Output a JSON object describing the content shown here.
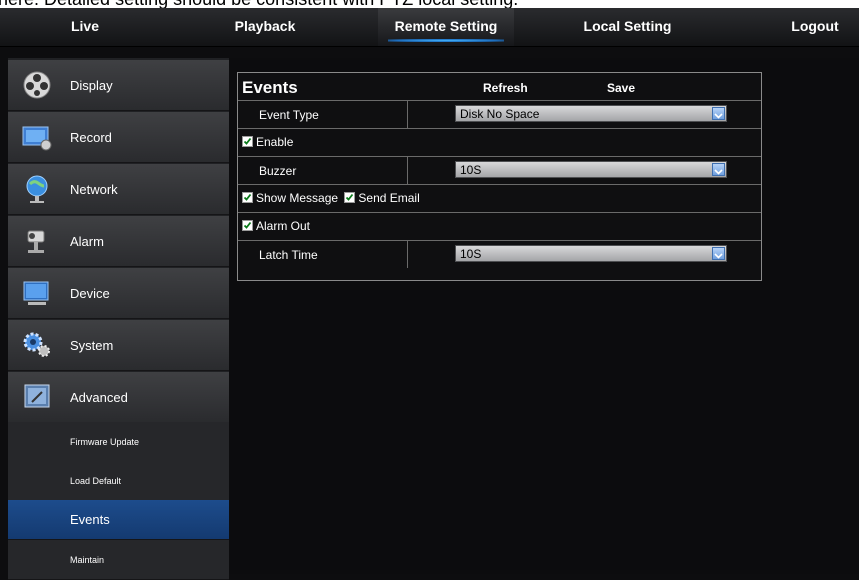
{
  "caption": "here. Detailed setting should be consistent with PTZ local setting.",
  "topnav": {
    "items": [
      {
        "label": "Live"
      },
      {
        "label": "Playback"
      },
      {
        "label": "Remote Setting"
      },
      {
        "label": "Local Setting"
      },
      {
        "label": "Logout"
      }
    ],
    "active": "Remote Setting"
  },
  "sidebar": {
    "items": [
      {
        "label": "Display",
        "icon": "display-icon"
      },
      {
        "label": "Record",
        "icon": "record-icon"
      },
      {
        "label": "Network",
        "icon": "network-icon"
      },
      {
        "label": "Alarm",
        "icon": "alarm-icon"
      },
      {
        "label": "Device",
        "icon": "device-icon"
      },
      {
        "label": "System",
        "icon": "system-icon"
      },
      {
        "label": "Advanced",
        "icon": "advanced-icon"
      }
    ],
    "subitems": [
      {
        "label": "Firmware Update"
      },
      {
        "label": "Load Default"
      },
      {
        "label": "Events"
      },
      {
        "label": "Maintain"
      }
    ],
    "active_subitem": "Events"
  },
  "panel": {
    "title": "Events",
    "refresh_label": "Refresh",
    "save_label": "Save",
    "event_type": {
      "label": "Event Type",
      "value": "Disk No Space"
    },
    "enable": {
      "label": "Enable",
      "checked": true
    },
    "buzzer": {
      "label": "Buzzer",
      "value": "10S"
    },
    "show_message": {
      "label": "Show Message",
      "checked": true
    },
    "send_email": {
      "label": "Send Email",
      "checked": true
    },
    "alarm_out": {
      "label": "Alarm Out",
      "checked": true
    },
    "latch_time": {
      "label": "Latch Time",
      "value": "10S"
    }
  },
  "colors": {
    "accent": "#1d4c8c",
    "background": "#0d0d0f",
    "sidebar": "#202124"
  }
}
